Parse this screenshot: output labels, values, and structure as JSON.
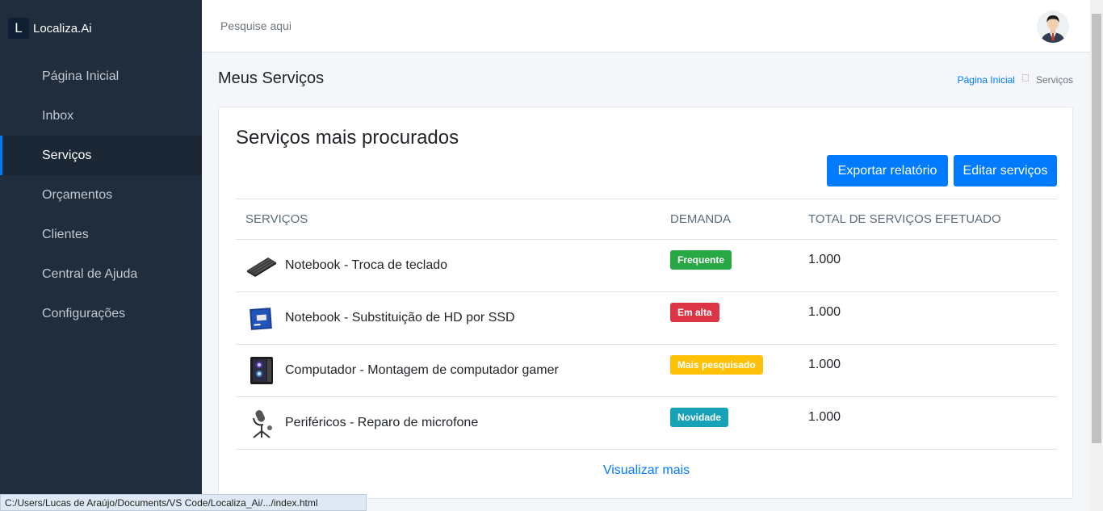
{
  "brand": {
    "logo_letter": "L",
    "name": "Localiza.Ai"
  },
  "sidebar": {
    "items": [
      {
        "label": "Página Inicial",
        "active": false
      },
      {
        "label": "Inbox",
        "active": false
      },
      {
        "label": "Serviços",
        "active": true
      },
      {
        "label": "Orçamentos",
        "active": false
      },
      {
        "label": "Clientes",
        "active": false
      },
      {
        "label": "Central de Ajuda",
        "active": false
      },
      {
        "label": "Configurações",
        "active": false
      }
    ]
  },
  "topbar": {
    "search_placeholder": "Pesquise aqui"
  },
  "header": {
    "title": "Meus Serviços",
    "breadcrumb": {
      "home": "Página Inicial",
      "current": "Serviços"
    }
  },
  "card": {
    "title": "Serviços mais procurados",
    "export_label": "Exportar relatório",
    "edit_label": "Editar serviços",
    "columns": [
      "SERVIÇOS",
      "DEMANDA",
      "TOTAL DE SERVIÇOS EFETUADO"
    ],
    "rows": [
      {
        "service": "Notebook - Troca de teclado",
        "icon": "keyboard-icon",
        "demand": "Frequente",
        "demand_color": "#28a745",
        "total": "1.000"
      },
      {
        "service": "Notebook - Substituição de HD por SSD",
        "icon": "ssd-icon",
        "demand": "Em alta",
        "demand_color": "#dc3545",
        "total": "1.000"
      },
      {
        "service": "Computador - Montagem de computador gamer",
        "icon": "pc-case-icon",
        "demand": "Mais pesquisado",
        "demand_color": "#ffc107",
        "total": "1.000"
      },
      {
        "service": "Periféricos - Reparo de microfone",
        "icon": "microphone-icon",
        "demand": "Novidade",
        "demand_color": "#17a2b8",
        "total": "1.000"
      }
    ],
    "view_more": "Visualizar mais"
  },
  "statusbar": {
    "url": "C:/Users/Lucas de Araújo/Documents/VS Code/Localiza_Ai/.../index.html"
  },
  "colors": {
    "sidebar_bg": "#1f2d3d",
    "accent": "#007bff"
  }
}
